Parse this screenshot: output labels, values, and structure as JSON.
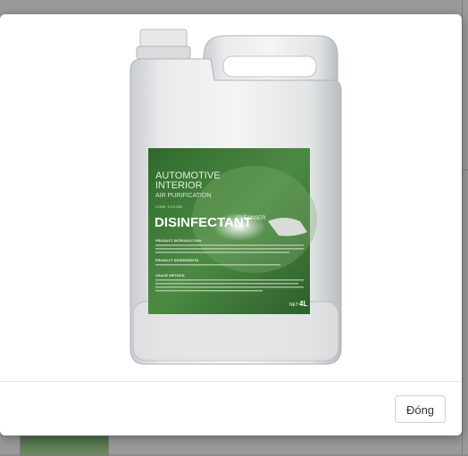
{
  "modal": {
    "close_label": "Đóng"
  },
  "product": {
    "headline1": "AUTOMOTIVE",
    "headline2": "INTERIOR",
    "headline3": "AIR PURIFICATION",
    "code_label": "CODE: CCS-002",
    "title": "DISINFECTANT",
    "brand_mark": "CLEANSER",
    "section_intro": "PRODUCT INTRODUCTION",
    "section_ingredients": "PRODUCT INGREDIENTS",
    "section_usage": "USAGE METHOD",
    "net_label": "NET",
    "net_value": "4L",
    "label_color": "#3f7d3a"
  }
}
